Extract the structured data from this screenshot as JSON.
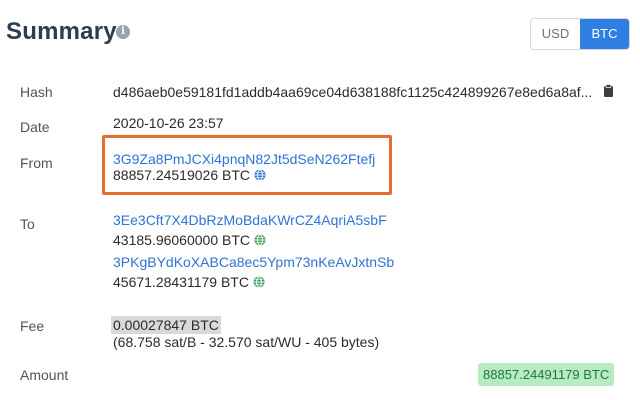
{
  "summary": {
    "title": "Summary",
    "info_icon": "info-icon"
  },
  "currency_toggle": {
    "options": [
      "USD",
      "BTC"
    ],
    "selected": "BTC"
  },
  "rows": {
    "hash": {
      "label": "Hash",
      "value": "d486aeb0e59181fd1addb4aa69ce04d638188fc1125c424899267e8ed6a8af...",
      "icon": "copy-icon"
    },
    "date": {
      "label": "Date",
      "value": "2020-10-26 23:57"
    },
    "from": {
      "label": "From",
      "address": "3G9Za8PmJCXi4pnqN82Jt5dSeN262Ftefj",
      "amount": "88857.24519026 BTC"
    },
    "to": {
      "label": "To",
      "outputs": [
        {
          "address": "3Ee3Cft7X4DbRzMoBdaKWrCZ4AqriA5sbF",
          "amount": "43185.96060000 BTC"
        },
        {
          "address": "3PKgBYdKoXABCa8ec5Ypm73nKeAvJxtnSb",
          "amount": "45671.28431179 BTC"
        }
      ]
    },
    "fee": {
      "label": "Fee",
      "value": "0.00027847 BTC",
      "detail": "(68.758 sat/B - 32.570 sat/WU - 405 bytes)"
    },
    "amount": {
      "label": "Amount",
      "value": "88857.24491179 BTC"
    }
  },
  "colors": {
    "link": "#2f73d4",
    "toggle_active": "#2f7fe3",
    "highlight_border": "#e26f2f",
    "amount_badge_bg": "#b6ebc4",
    "amount_badge_text": "#207a3c",
    "globe_from": "#2f73d4",
    "globe_to": "#3aa35a"
  }
}
